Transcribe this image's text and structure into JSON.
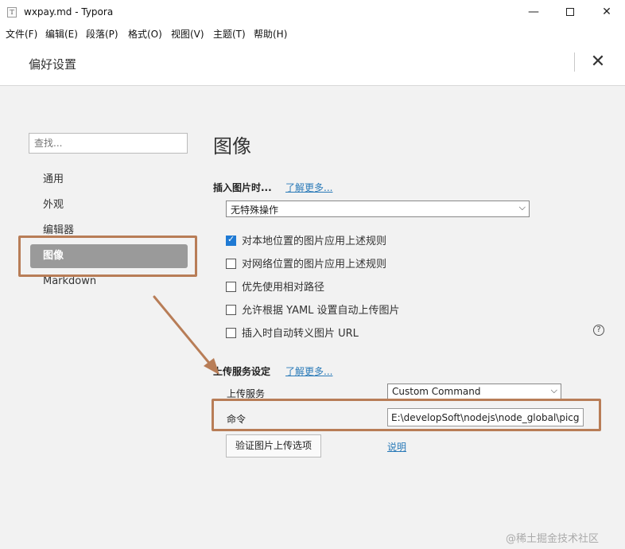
{
  "window": {
    "app_icon_glyph": "T",
    "title": "wxpay.md - Typora",
    "minimize_glyph": "—",
    "close_glyph": "✕"
  },
  "menu": [
    "文件(F)",
    "编辑(E)",
    "段落(P)",
    "格式(O)",
    "视图(V)",
    "主题(T)",
    "帮助(H)"
  ],
  "preferences": {
    "title": "偏好设置",
    "close_glyph": "✕"
  },
  "sidebar": {
    "search_placeholder": "查找...",
    "items": [
      "通用",
      "外观",
      "编辑器",
      "图像",
      "Markdown"
    ],
    "active_index": 3
  },
  "main": {
    "heading": "图像",
    "insert_section": {
      "title": "插入图片时...",
      "learn_more": "了解更多...",
      "selected_option": "无特殊操作"
    },
    "checkboxes": [
      {
        "label": "对本地位置的图片应用上述规则",
        "checked": true
      },
      {
        "label": "对网络位置的图片应用上述规则",
        "checked": false
      },
      {
        "label": "优先使用相对路径",
        "checked": false
      },
      {
        "label": "允许根据 YAML 设置自动上传图片",
        "checked": false
      },
      {
        "label": "插入时自动转义图片 URL",
        "checked": false
      }
    ],
    "help_glyph": "?",
    "upload_section": {
      "title": "上传服务设定",
      "learn_more": "了解更多...",
      "service_label": "上传服务",
      "service_value": "Custom Command",
      "command_label": "命令",
      "command_value": "E:\\developSoft\\nodejs\\node_global\\picgo upload",
      "verify_button": "验证图片上传选项",
      "explain_link": "说明"
    }
  },
  "colors": {
    "highlight_border": "#b87d57",
    "link": "#2a7ab8",
    "checkbox_checked": "#1f7ad4",
    "active_nav": "#9a9a9a"
  },
  "watermark": "@稀土掘金技术社区"
}
